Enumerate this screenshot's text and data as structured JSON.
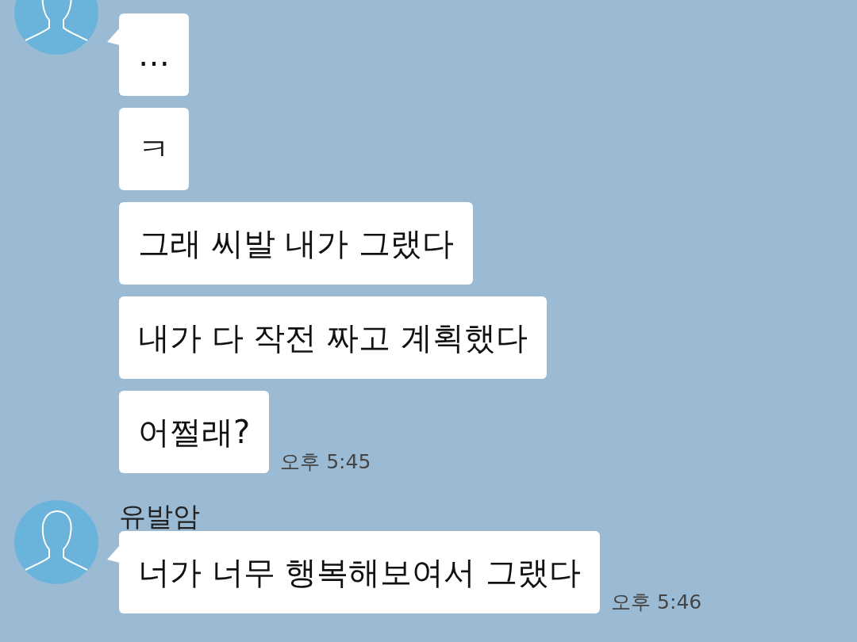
{
  "groups": [
    {
      "messages": [
        "…",
        "ㅋ",
        "그래 씨발 내가 그랬다",
        "내가 다 작전 짜고 계획했다",
        "어쩔래?"
      ],
      "time": "오후 5:45"
    },
    {
      "sender": "유발암",
      "messages": [
        "너가 너무 행복해보여서 그랬다"
      ],
      "time": "오후 5:46"
    }
  ]
}
